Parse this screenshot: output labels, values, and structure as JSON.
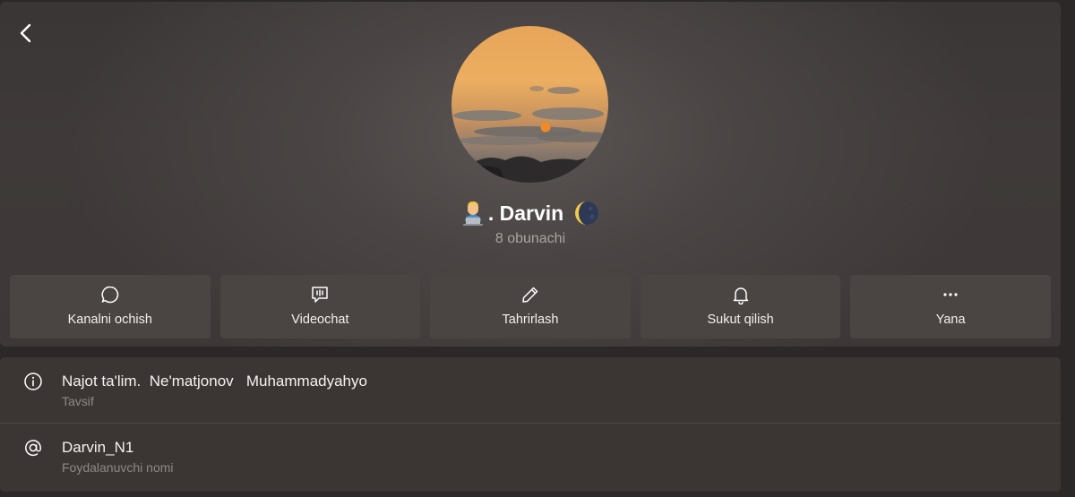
{
  "header": {
    "channel_name": ". Darvin",
    "subscribers": "8 obunachi"
  },
  "actions": [
    {
      "label": "Kanalni ochish",
      "icon": "chat-bubble-icon"
    },
    {
      "label": "Videochat",
      "icon": "video-chat-icon"
    },
    {
      "label": "Tahrirlash",
      "icon": "pencil-icon"
    },
    {
      "label": "Sukut qilish",
      "icon": "bell-icon"
    },
    {
      "label": "Yana",
      "icon": "more-dots-icon"
    }
  ],
  "info": {
    "description": {
      "value": "Najot ta'lim.  Ne'matjonov   Muhammadyahyo",
      "caption": "Tavsif",
      "icon": "info-icon"
    },
    "username": {
      "value": "Darvin_N1",
      "caption": "Foydalanuvchi nomi",
      "icon": "at-sign-icon"
    }
  },
  "colors": {
    "background": "#2b2827",
    "action_button": "#4a4443",
    "info_card": "#3b3534",
    "muted_text": "#a9a4a2"
  }
}
